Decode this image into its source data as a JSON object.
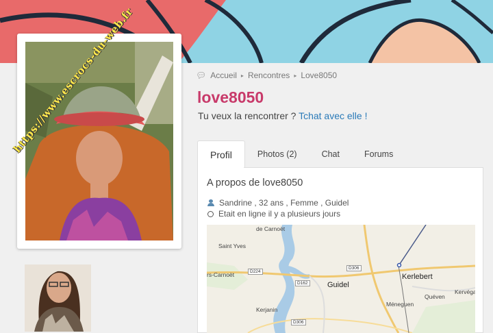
{
  "watermark": "https://www.escrocs-du-web.fr",
  "breadcrumb": {
    "home_icon": "chat-bubble-icon",
    "items": [
      "Accueil",
      "Rencontres",
      "Love8050"
    ],
    "separator": "▸"
  },
  "profile": {
    "name": "love8050",
    "invite_text": "Tu veux la rencontrer ? ",
    "invite_link": "Tchat avec elle !"
  },
  "tabs": [
    "Profil",
    "Photos (2)",
    "Chat",
    "Forums"
  ],
  "active_tab": "Profil",
  "about": {
    "title": "A propos de love8050",
    "details": "Sandrine , 32 ans , Femme , Guidel",
    "status": "Etait en ligne il y a plusieurs jours"
  },
  "map": {
    "places": [
      "de Carnoët",
      "Saint Yves",
      "rs-Carnoët",
      "Guidel",
      "Kerlebert",
      "Kervéga",
      "Quéven",
      "Méneguen",
      "Kerjanin"
    ],
    "roads": [
      "D306",
      "D224",
      "D162",
      "D306"
    ]
  },
  "colors": {
    "accent": "#c83a6a",
    "link": "#2a7ab8",
    "banner_blue": "#8fd3e4",
    "banner_red": "#e86a6a"
  }
}
